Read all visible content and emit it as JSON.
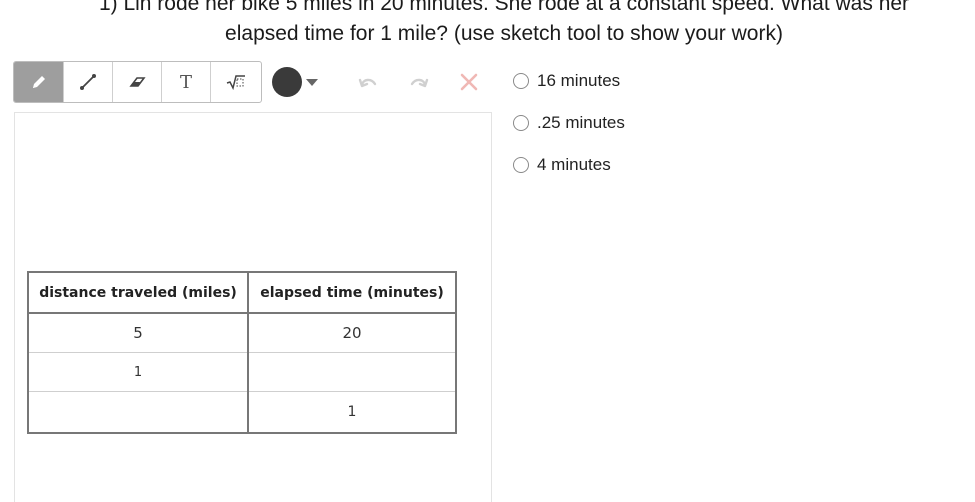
{
  "question": {
    "line1": "1) Lin rode her bike 5 miles in 20 minutes. She rode at a constant speed. What was her",
    "line2": "elapsed time for 1 mile? (use sketch tool to show your work)"
  },
  "toolbar": {
    "tools": [
      {
        "name": "pencil-icon",
        "active": true
      },
      {
        "name": "line-icon",
        "active": false
      },
      {
        "name": "eraser-icon",
        "active": false
      },
      {
        "name": "text-tool",
        "label": "T",
        "active": false
      },
      {
        "name": "math-icon",
        "active": false
      }
    ],
    "color": "#3a3a3a",
    "disabled_color": "#d0d0d0",
    "delete_color": "#f0b8b4"
  },
  "table": {
    "headers": [
      "distance traveled (miles)",
      "elapsed time (minutes)"
    ],
    "rows": [
      [
        "5",
        "20"
      ],
      [
        "1",
        ""
      ],
      [
        "",
        "1"
      ]
    ]
  },
  "choices": [
    {
      "label": "16 minutes"
    },
    {
      "label": ".25 minutes"
    },
    {
      "label": "4 minutes"
    }
  ]
}
